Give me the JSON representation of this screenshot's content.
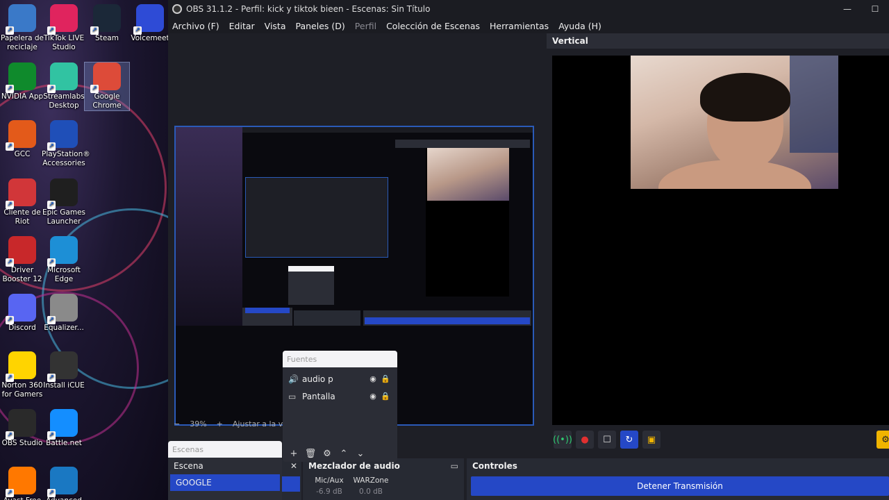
{
  "desktop": {
    "icons": [
      {
        "label": "Papelera de reciclaje",
        "icon": "recycle-bin-icon",
        "color": "#3a79c8"
      },
      {
        "label": "TikTok LIVE Studio",
        "icon": "tiktok-icon",
        "color": "#e0245e"
      },
      {
        "label": "Steam",
        "icon": "steam-icon",
        "color": "#1b2838"
      },
      {
        "label": "Voicemeet",
        "icon": "voicemeeter-icon",
        "color": "#2e4bd6"
      },
      {
        "label": "NVIDIA App",
        "icon": "nvidia-icon",
        "color": "#0f8a2c"
      },
      {
        "label": "Streamlabs Desktop",
        "icon": "streamlabs-icon",
        "color": "#31c3a2"
      },
      {
        "label": "Google Chrome",
        "icon": "chrome-icon",
        "color": "#dd4b39"
      },
      {
        "label": "GCC",
        "icon": "gcc-icon",
        "color": "#e35a1a"
      },
      {
        "label": "PlayStation® Accessories",
        "icon": "playstation-icon",
        "color": "#1f4fb8"
      },
      {
        "label": "Cliente de Riot",
        "icon": "riot-icon",
        "color": "#d13639"
      },
      {
        "label": "Epic Games Launcher",
        "icon": "epic-icon",
        "color": "#1f1f1f"
      },
      {
        "label": "Driver Booster 12",
        "icon": "driver-booster-icon",
        "color": "#c8282a"
      },
      {
        "label": "Microsoft Edge",
        "icon": "edge-icon",
        "color": "#1d8fd6"
      },
      {
        "label": "Discord",
        "icon": "discord-icon",
        "color": "#5865f2"
      },
      {
        "label": "Equalizer...",
        "icon": "equalizer-icon",
        "color": "#8a8a8a"
      },
      {
        "label": "Norton 360 for Gamers",
        "icon": "norton-icon",
        "color": "#ffd400"
      },
      {
        "label": "Install iCUE",
        "icon": "icue-icon",
        "color": "#333333"
      },
      {
        "label": "OBS Studio",
        "icon": "obs-icon",
        "color": "#2a2a2a"
      },
      {
        "label": "Battle.net",
        "icon": "battlenet-icon",
        "color": "#148eff"
      },
      {
        "label": "Avast Free",
        "icon": "avast-icon",
        "color": "#ff7800"
      },
      {
        "label": "Advanced",
        "icon": "advanced-icon",
        "color": "#1a78c2"
      }
    ]
  },
  "window": {
    "title": "OBS 31.1.2 - Perfil: kick y tiktok bieen - Escenas: Sin Título",
    "minimize": "—",
    "maximize": "☐"
  },
  "menu": [
    "Archivo (F)",
    "Editar",
    "Vista",
    "Paneles (D)",
    "Perfil",
    "Colección de Escenas",
    "Herramientas",
    "Ayuda (H)"
  ],
  "zoom": {
    "minus": "−",
    "value": "39%",
    "plus": "+",
    "fit": "Ajustar a la ventana"
  },
  "vertical": {
    "title": "Vertical"
  },
  "fuentes": {
    "title": "Fuentes",
    "items": [
      {
        "label": "audio p",
        "icon": "speaker-icon"
      },
      {
        "label": "Pantalla",
        "icon": "monitor-icon"
      }
    ]
  },
  "escenas": {
    "title": "Escenas",
    "items": [
      "Escena",
      "GOOGLE"
    ],
    "active": "GOOGLE"
  },
  "mixer": {
    "title": "Mezclador de audio",
    "channels": [
      {
        "name": "Mic/Aux",
        "db": "-6.9 dB"
      },
      {
        "name": "WARZone",
        "db": "0.0 dB"
      }
    ]
  },
  "controls": {
    "title": "Controles",
    "stop_stream": "Detener Transmisión"
  },
  "colors": {
    "accent": "#2548c6",
    "bg": "#1e1f26",
    "dock": "#2b2d36"
  }
}
